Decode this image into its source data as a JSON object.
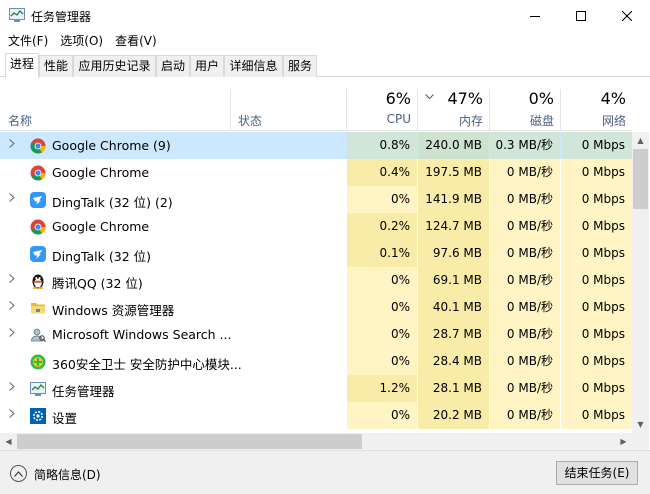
{
  "window": {
    "title": "任务管理器",
    "icon": "task-manager-icon",
    "controls": {
      "minimize": "—",
      "maximize": "☐",
      "close": "✕"
    }
  },
  "menu": [
    {
      "label": "文件(F)"
    },
    {
      "label": "选项(O)"
    },
    {
      "label": "查看(V)"
    }
  ],
  "tabs": [
    {
      "label": "进程",
      "active": true
    },
    {
      "label": "性能"
    },
    {
      "label": "应用历史记录"
    },
    {
      "label": "启动"
    },
    {
      "label": "用户"
    },
    {
      "label": "详细信息"
    },
    {
      "label": "服务"
    }
  ],
  "columns": {
    "name": {
      "label": "名称"
    },
    "status": {
      "label": "状态"
    },
    "cpu": {
      "label": "CPU",
      "pct": "6%"
    },
    "memory": {
      "label": "内存",
      "pct": "47%",
      "sorted": true
    },
    "disk": {
      "label": "磁盘",
      "pct": "0%"
    },
    "network": {
      "label": "网络",
      "pct": "4%"
    }
  },
  "processes": [
    {
      "name": "Google Chrome (9)",
      "icon": "chrome-icon",
      "expandable": true,
      "selected": true,
      "cpu": "0.8%",
      "memory": "240.0 MB",
      "disk": "0.3 MB/秒",
      "network": "0 Mbps"
    },
    {
      "name": "Google Chrome",
      "icon": "chrome-icon",
      "expandable": false,
      "cpu": "0.4%",
      "memory": "197.5 MB",
      "disk": "0 MB/秒",
      "network": "0 Mbps"
    },
    {
      "name": "DingTalk (32 位) (2)",
      "icon": "dingtalk-icon",
      "expandable": true,
      "cpu": "0%",
      "memory": "141.9 MB",
      "disk": "0 MB/秒",
      "network": "0 Mbps"
    },
    {
      "name": "Google Chrome",
      "icon": "chrome-icon",
      "expandable": false,
      "cpu": "0.2%",
      "memory": "124.7 MB",
      "disk": "0 MB/秒",
      "network": "0 Mbps"
    },
    {
      "name": "DingTalk (32 位)",
      "icon": "dingtalk-icon",
      "expandable": false,
      "cpu": "0.1%",
      "memory": "97.6 MB",
      "disk": "0 MB/秒",
      "network": "0 Mbps"
    },
    {
      "name": "腾讯QQ (32 位)",
      "icon": "qq-penguin-icon",
      "expandable": true,
      "cpu": "0%",
      "memory": "69.1 MB",
      "disk": "0 MB/秒",
      "network": "0 Mbps"
    },
    {
      "name": "Windows 资源管理器",
      "icon": "folder-icon",
      "expandable": true,
      "cpu": "0%",
      "memory": "40.1 MB",
      "disk": "0 MB/秒",
      "network": "0 Mbps"
    },
    {
      "name": "Microsoft Windows Search ...",
      "icon": "search-user-icon",
      "expandable": true,
      "cpu": "0%",
      "memory": "28.7 MB",
      "disk": "0 MB/秒",
      "network": "0 Mbps"
    },
    {
      "name": "360安全卫士 安全防护中心模块...",
      "icon": "360-shield-icon",
      "expandable": false,
      "cpu": "0%",
      "memory": "28.4 MB",
      "disk": "0 MB/秒",
      "network": "0 Mbps"
    },
    {
      "name": "任务管理器",
      "icon": "task-manager-icon",
      "expandable": true,
      "cpu": "1.2%",
      "memory": "28.1 MB",
      "disk": "0 MB/秒",
      "network": "0 Mbps"
    },
    {
      "name": "设置",
      "icon": "gear-icon",
      "expandable": true,
      "cpu": "0%",
      "memory": "20.2 MB",
      "disk": "0 MB/秒",
      "network": "0 Mbps"
    }
  ],
  "footer": {
    "fewer_details": "简略信息(D)",
    "end_task": "结束任务(E)"
  }
}
